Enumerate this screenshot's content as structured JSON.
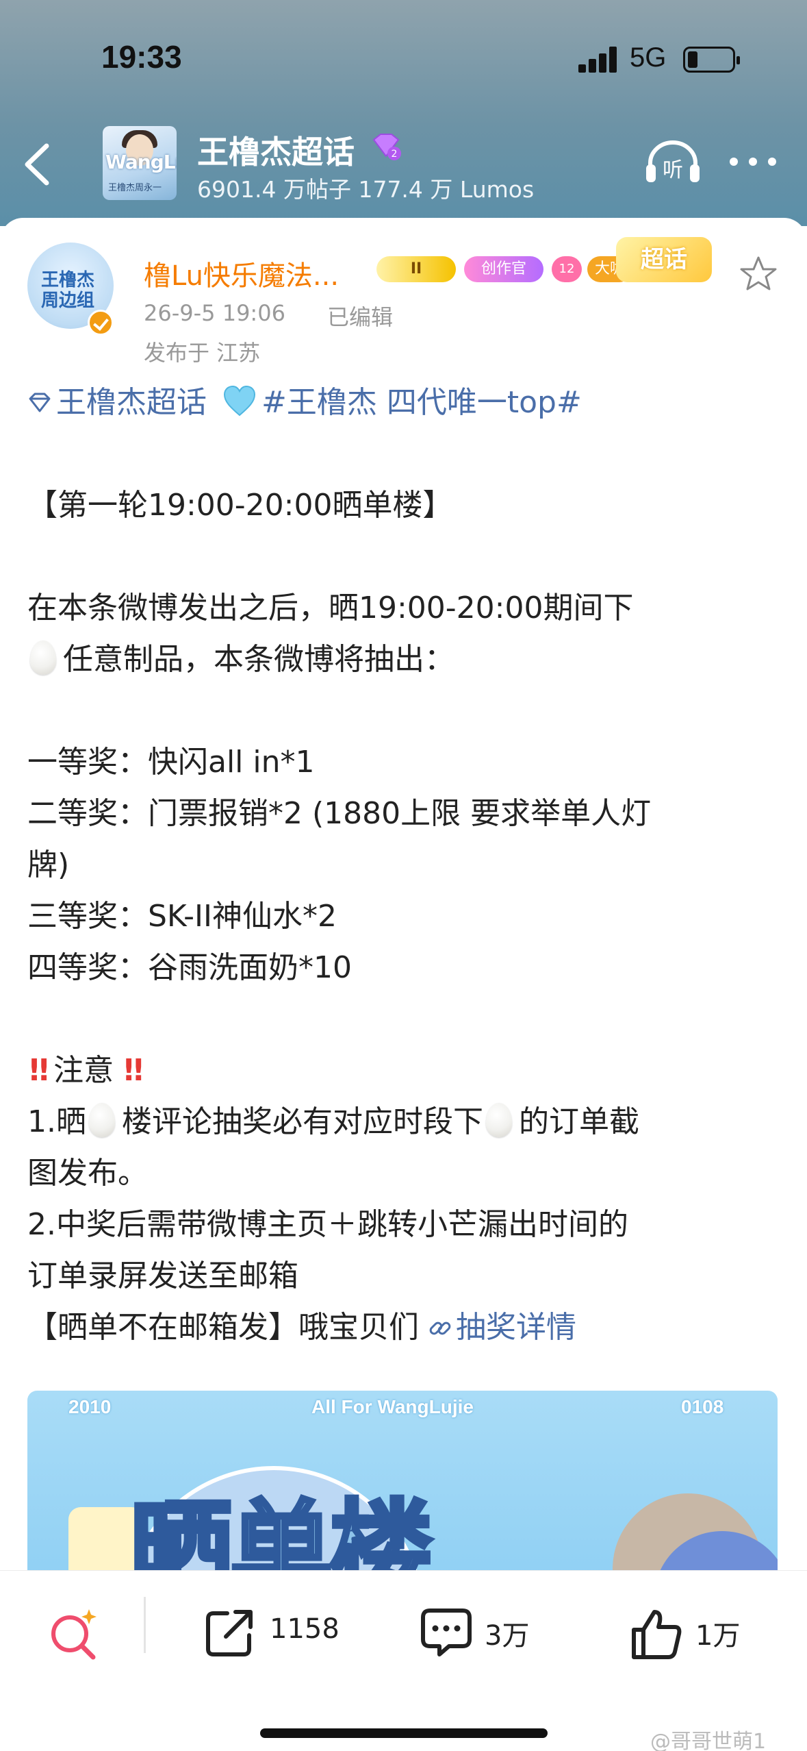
{
  "status_bar": {
    "time": "19:33",
    "network": "5G",
    "battery_level": 0.15
  },
  "topic": {
    "thumb_title": "WangLujie",
    "thumb_caption": "王橹杰周永一",
    "title": "王橹杰超话",
    "badge_level": "2",
    "stats": "6901.4 万帖子 177.4 万 Lumos",
    "listen_label": "听"
  },
  "post": {
    "avatar_text": "王橹杰\n周边组",
    "username": "橹Lu快乐魔法...",
    "badges": {
      "crown": "II",
      "creator": "创作官",
      "level": "12",
      "dakai": "大咖",
      "chaohua": "超话"
    },
    "date": "26-9-5 19:06",
    "edited": "已编辑",
    "location": "发布于 江苏",
    "tags": {
      "topic": "王橹杰超话",
      "hashtag": "#王橹杰 四代唯一top#"
    },
    "round_title": "【第一轮19:00-20:00晒单楼】",
    "intro_1": "在本条微博发出之后，晒19:00-20:00期间下",
    "intro_2": "任意制品，本条微博将抽出：",
    "prize_1": "一等奖：快闪all in*1",
    "prize_2": "二等奖：门票报销*2 (1880上限 要求举单人灯",
    "prize_2b": "牌)",
    "prize_3": "三等奖：SK-II神仙水*2",
    "prize_4": "四等奖：谷雨洗面奶*10",
    "notice_title": "注意",
    "notice_1a": "1.晒",
    "notice_1b": "楼评论抽奖必有对应时段下",
    "notice_1c": "的订单截",
    "notice_1d": "图发布。",
    "notice_2a": "2.中奖后需带微博主页＋跳转小芒漏出时间的",
    "notice_2b": "订单录屏发送至邮箱",
    "footer_text": "【晒单不在邮箱发】哦宝贝们",
    "lottery_link": "抽奖详情",
    "image": {
      "left_year": "2010",
      "center": "All For WangLujie",
      "right_date": "0108",
      "big_text": "晒单楼"
    }
  },
  "toolbar": {
    "share_count": "1158",
    "comment_count": "3万",
    "like_count": "1万"
  },
  "watermark": "@哥哥世萌1"
}
